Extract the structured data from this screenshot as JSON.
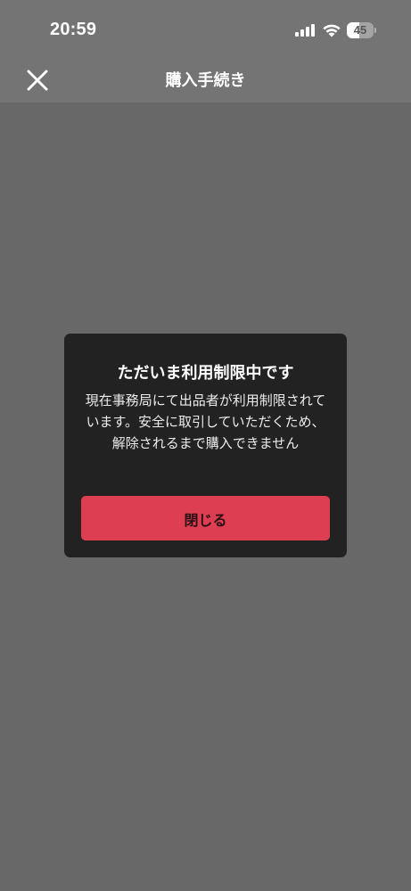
{
  "status_bar": {
    "time": "20:59",
    "battery_level": "45",
    "battery_fraction": 0.45,
    "icons": [
      "signal-icon",
      "wifi-icon",
      "battery-icon"
    ]
  },
  "header": {
    "title": "購入手続き",
    "close_icon": "close-icon"
  },
  "dialog": {
    "title": "ただいま利用制限中です",
    "message": "現在事務局にて出品者が利用制限されています。安全に取引していただくため、解除されるまで購入できません",
    "button_label": "閉じる"
  },
  "colors": {
    "overlay_background": "#686868",
    "header_background": "#747474",
    "dialog_background": "#222222",
    "primary_button": "#dd3e52",
    "text": "#ffffff"
  }
}
